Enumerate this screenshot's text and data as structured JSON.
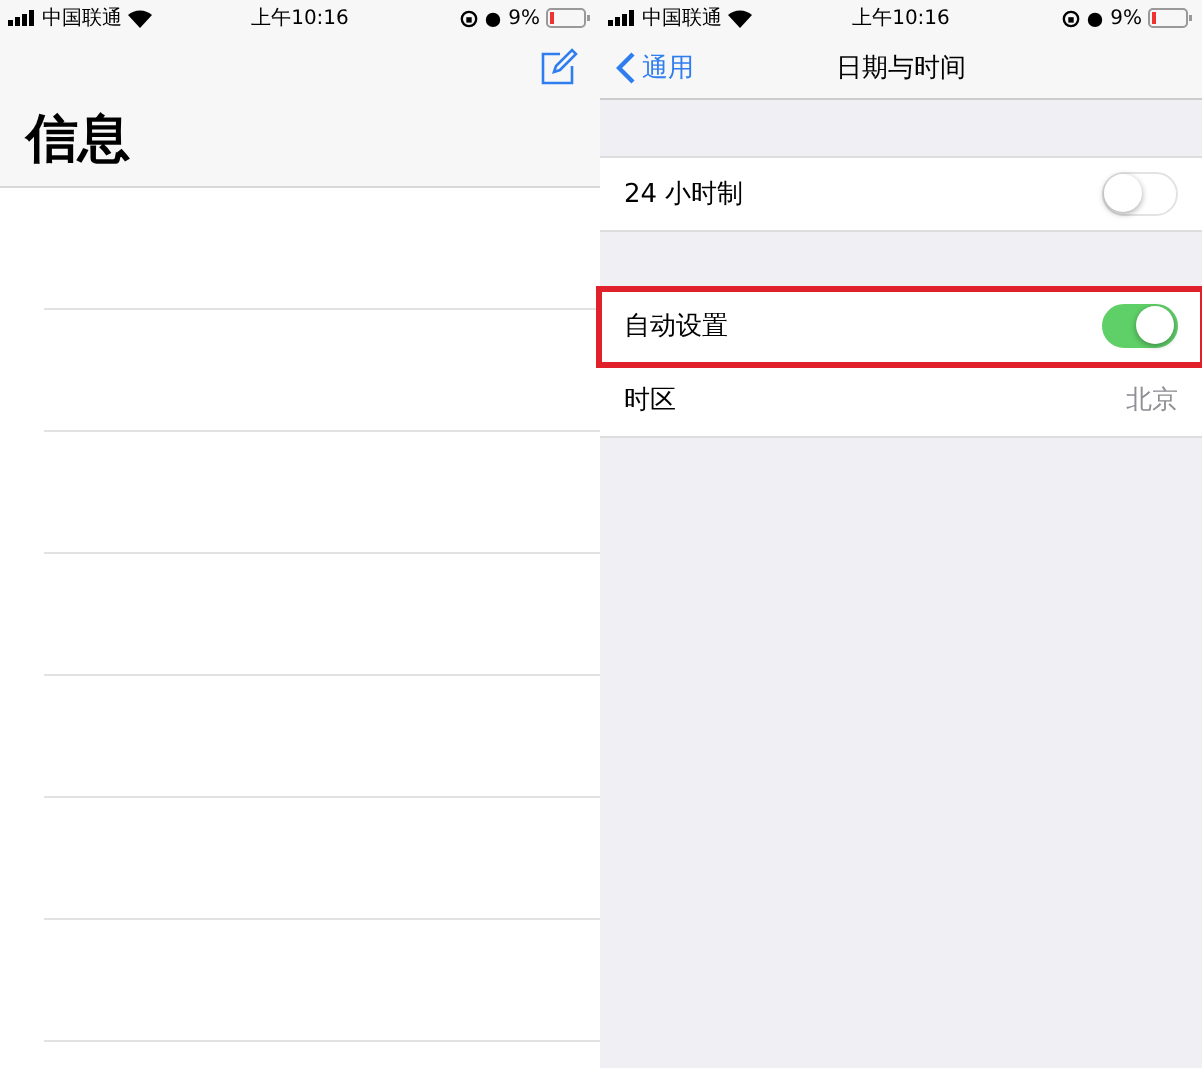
{
  "left_screen": {
    "status_bar": {
      "carrier": "中国联通",
      "time": "上午10:16",
      "battery": "9%"
    },
    "title": "信息"
  },
  "right_screen": {
    "status_bar": {
      "carrier": "中国联通",
      "time": "上午10:16",
      "battery": "9%"
    },
    "nav": {
      "back": "通用",
      "title": "日期与时间"
    },
    "groups": [
      [
        {
          "kind": "switch",
          "label": "24 小时制",
          "on": false,
          "highlighted": false
        }
      ],
      [
        {
          "kind": "switch",
          "label": "自动设置",
          "on": true,
          "highlighted": true
        },
        {
          "kind": "value",
          "label": "时区",
          "value": "北京",
          "highlighted": false
        }
      ]
    ]
  }
}
